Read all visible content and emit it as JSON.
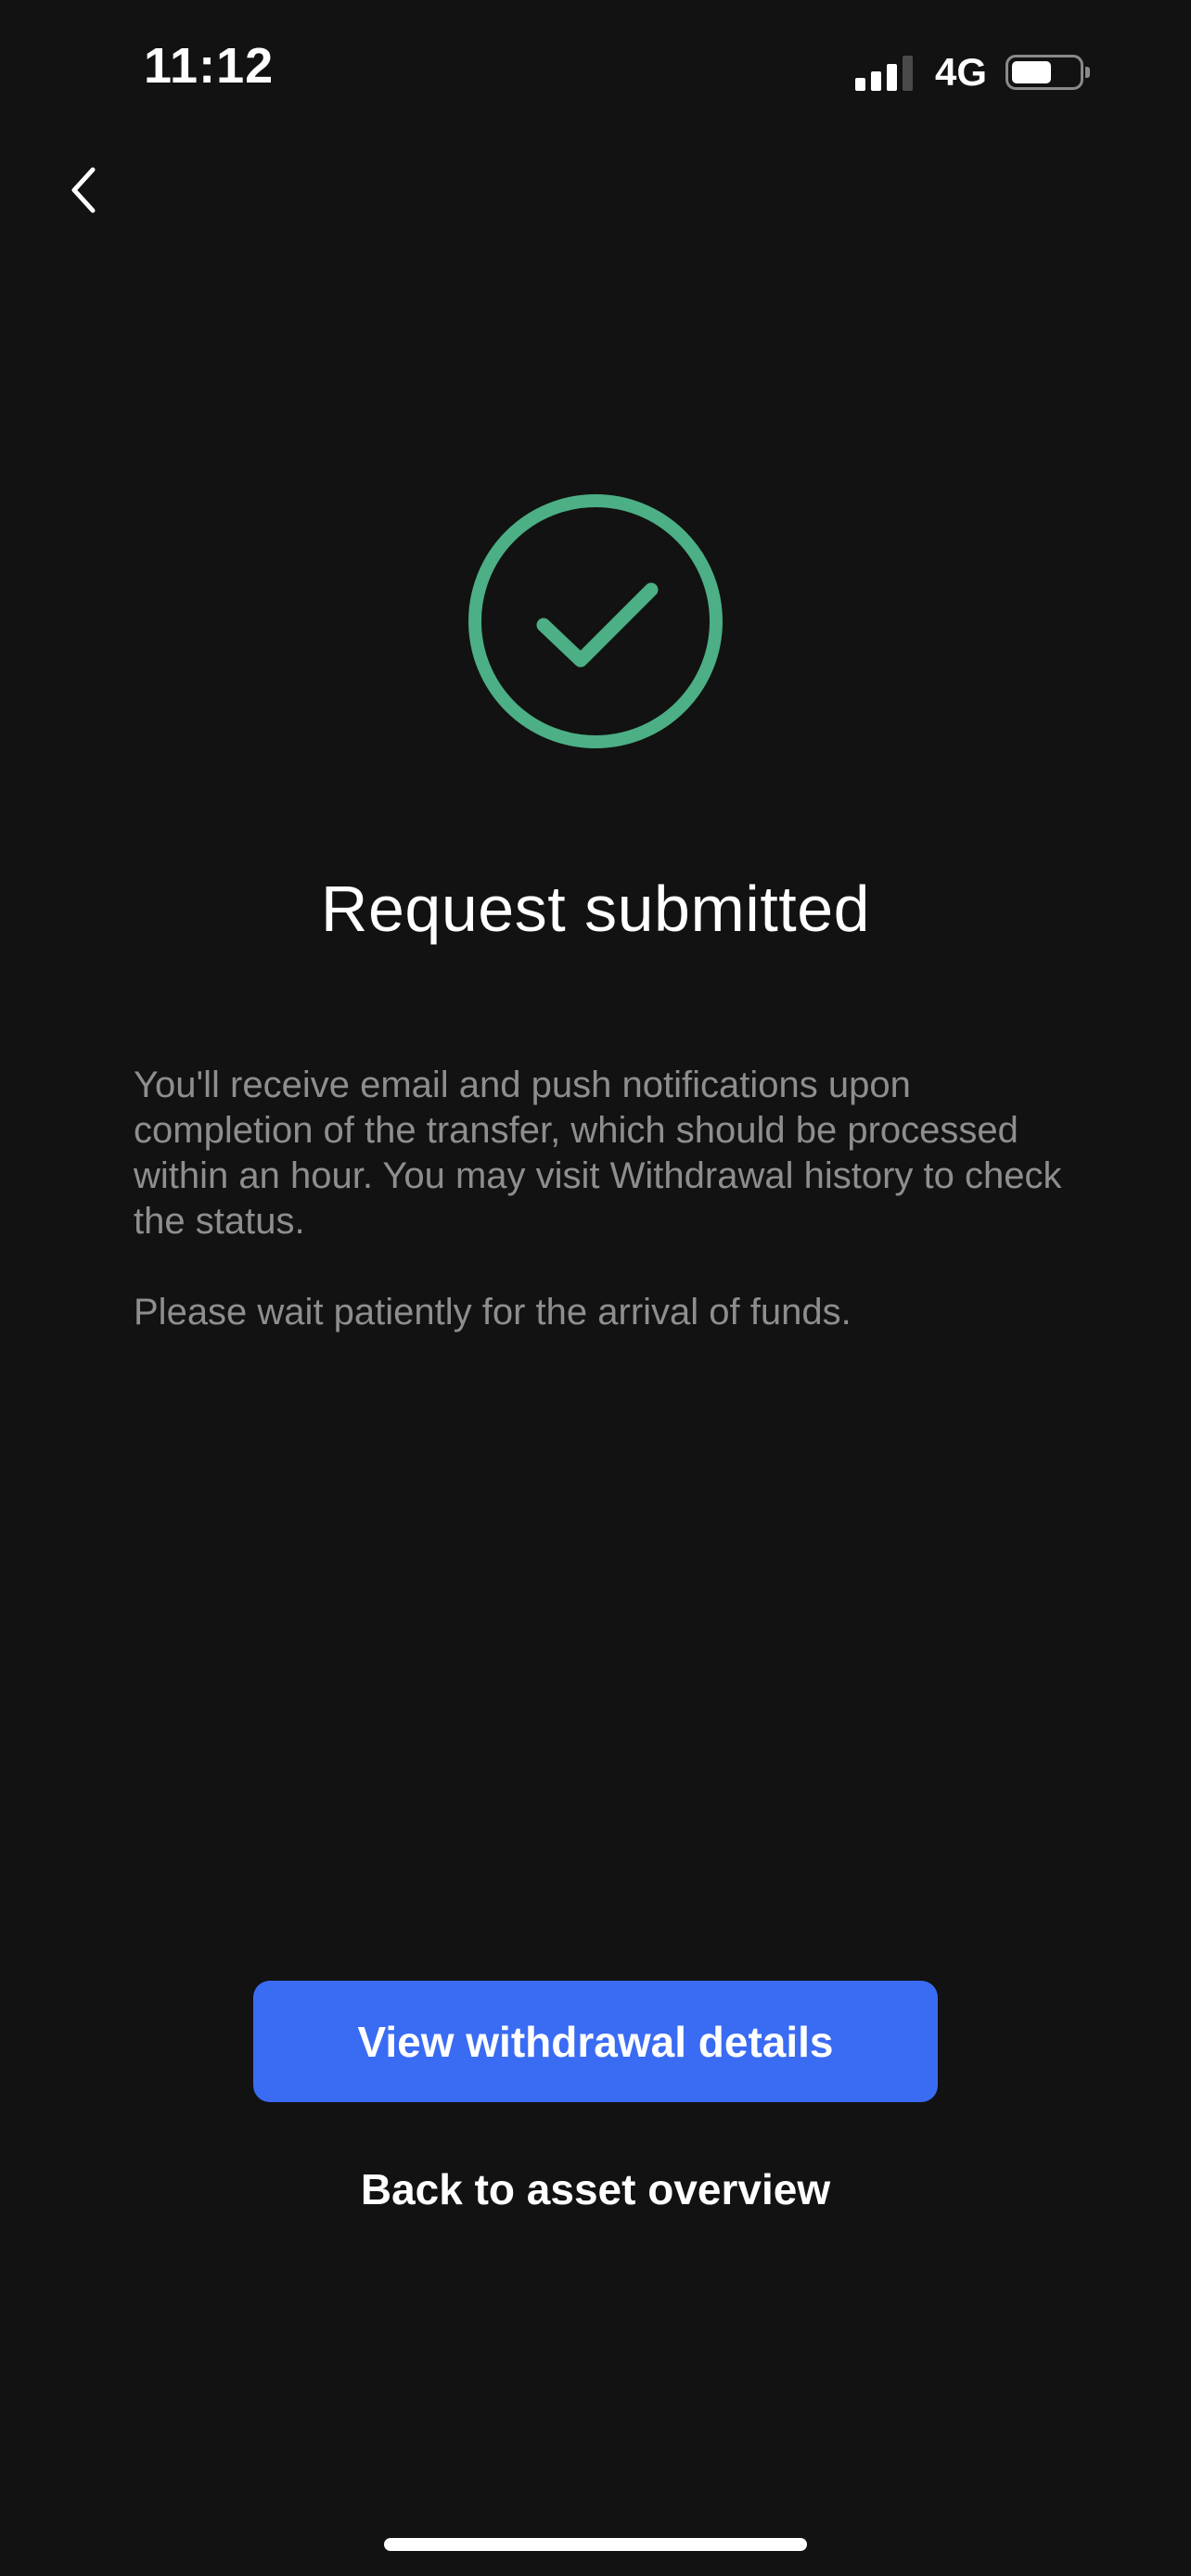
{
  "status_bar": {
    "time": "11:12",
    "network": "4G",
    "icons": [
      "signal-icon",
      "battery-icon"
    ]
  },
  "nav": {
    "back_icon": "chevron-left-icon"
  },
  "result": {
    "icon": "check-circle-icon",
    "icon_color": "#4caf85",
    "title": "Request submitted",
    "message_1": "You'll receive email and push notifications upon completion of the transfer, which should be processed within an hour. You may visit Withdrawal history to check the status.",
    "message_2": "Please wait patiently for the arrival of funds."
  },
  "actions": {
    "primary_label": "View withdrawal details",
    "primary_color": "#3a6bf3",
    "secondary_label": "Back to asset overview"
  }
}
